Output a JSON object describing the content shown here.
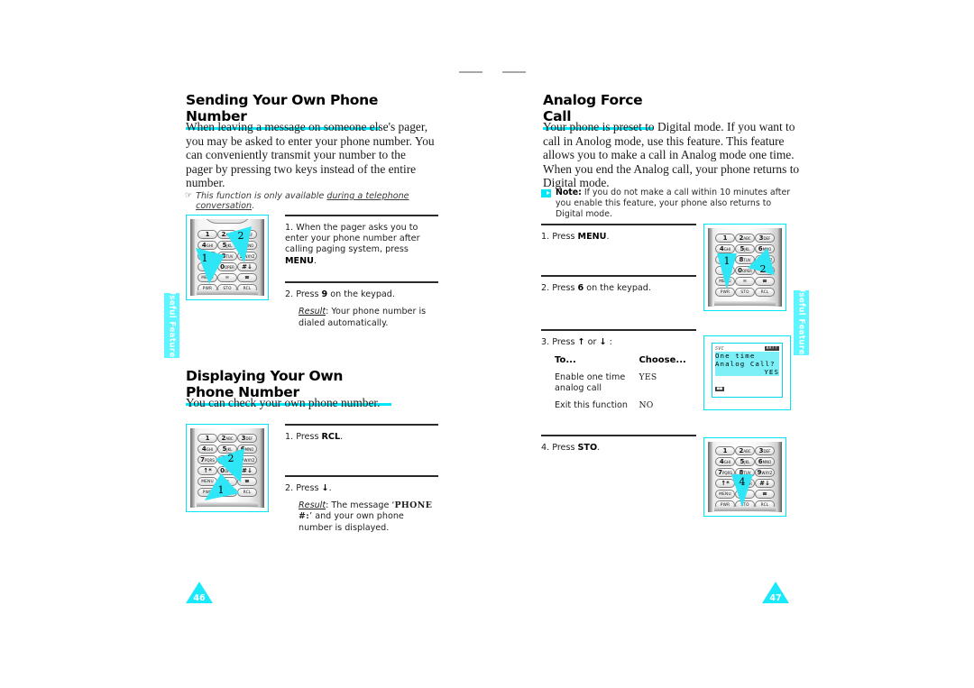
{
  "document": {
    "type": "phone-user-manual-spread",
    "accent_color": "#00e7f7",
    "side_tab_label": "Useful Features"
  },
  "left_page": {
    "number": "46",
    "sections": [
      {
        "title": "Sending Your Own Phone Number",
        "body": "When leaving a message on someone else's pager, you may be asked to enter your phone number. You can conveniently transmit your number to the pager by pressing two keys instead of the entire number.",
        "tip_icon": "pointing-hand-icon",
        "tip_prefix": "This function is only available ",
        "tip_underlined": "during a telephone conversation",
        "tip_suffix": ".",
        "steps": [
          {
            "text_before": "1. When the pager asks you to enter your phone number after calling paging system, press ",
            "bold": "MENU",
            "text_after": "."
          },
          {
            "text_before": "2. Press ",
            "bold": "9",
            "text_after": " on the keypad.",
            "result_label": "Result",
            "result_text": ": Your phone number is dialed automatically."
          }
        ],
        "keypad_callouts": [
          "1",
          "2"
        ]
      },
      {
        "title": "Displaying Your Own Phone Number",
        "body": "You can check your own phone number.",
        "steps": [
          {
            "text_before": "1. Press ",
            "bold": "RCL",
            "text_after": "."
          },
          {
            "text_before": "2. Press ",
            "bold": "↓",
            "text_after": ".",
            "result_label": "Result",
            "result_mid": ": The message ‘",
            "result_mono": "PHONE  #:",
            "result_end": "’ and your own phone number is displayed."
          }
        ],
        "keypad_callouts": [
          "2",
          "1"
        ]
      }
    ]
  },
  "right_page": {
    "number": "47",
    "sections": [
      {
        "title": "Analog Force Call",
        "body": "Your phone is preset to Digital mode. If you want to call in Anolog mode, use this feature. This feature allows you to make a call in Analog mode one time. When you end the Analog call, your phone returns to Digital mode.",
        "note_icon": "note-arrow-icon",
        "note_label": "Note:",
        "note_text": " If you do not make a call within 10 minutes after you enable this feature, your phone also returns to Digital mode.",
        "steps": [
          {
            "text_before": "1. Press ",
            "bold": "MENU",
            "text_after": "."
          },
          {
            "text_before": "2. Press ",
            "bold": "6",
            "text_after": " on the keypad."
          },
          {
            "text_before": "3. Press ",
            "bold": "↑",
            "text_mid": " or ",
            "bold2": "↓",
            "text_after": " :"
          },
          {
            "text_before": "4. Press ",
            "bold": "STO",
            "text_after": "."
          }
        ],
        "table": {
          "headers": [
            "To...",
            "Choose..."
          ],
          "rows": [
            {
              "to": "Enable one time analog call",
              "choose": "YES"
            },
            {
              "to": "Exit this function",
              "choose": "NO"
            }
          ]
        },
        "keypad_callouts_step2": [
          "1",
          "2"
        ],
        "keypad_callouts_step4": [
          "4"
        ]
      }
    ],
    "lcd": {
      "status_left": "SVC",
      "status_right": "BATT",
      "line1": "One time",
      "line2": "Analog Call?",
      "line3": "YES",
      "footer_icon": "roam-indicator"
    }
  },
  "keypad": {
    "rows": [
      [
        {
          "big": "1",
          "sub": ""
        },
        {
          "big": "2",
          "sub": "ABC"
        },
        {
          "big": "3",
          "sub": "DEF"
        }
      ],
      [
        {
          "big": "4",
          "sub": "GHI"
        },
        {
          "big": "5",
          "sub": "JKL"
        },
        {
          "big": "6",
          "sub": "MNO"
        }
      ],
      [
        {
          "big": "7",
          "sub": "PQRS"
        },
        {
          "big": "8",
          "sub": "TUV"
        },
        {
          "big": "9",
          "sub": "WXYZ"
        }
      ],
      [
        {
          "big": "↑∗",
          "sub": ""
        },
        {
          "big": "0",
          "sub": "OPER"
        },
        {
          "big": "#↓",
          "sub": ""
        }
      ]
    ],
    "fn_rows": [
      [
        "MENU",
        "✉",
        "☎"
      ],
      [
        "PWR",
        "STO",
        "RCL"
      ]
    ]
  }
}
